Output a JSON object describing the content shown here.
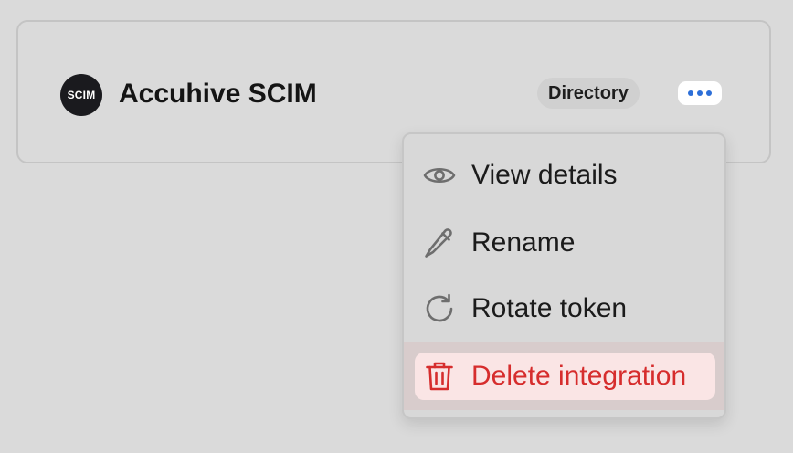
{
  "integration": {
    "logo_text": "SCIM",
    "name": "Accuhive SCIM",
    "badge": "Directory"
  },
  "menu": {
    "items": [
      {
        "label": "View details",
        "icon": "eye-icon"
      },
      {
        "label": "Rename",
        "icon": "pencil-icon"
      },
      {
        "label": "Rotate token",
        "icon": "rotate-icon"
      },
      {
        "label": "Delete integration",
        "icon": "trash-icon"
      }
    ]
  },
  "colors": {
    "accent": "#2d6fd8",
    "danger": "#d62d2d",
    "danger_bg": "#fae5e5",
    "icon": "#6e6e6e"
  }
}
